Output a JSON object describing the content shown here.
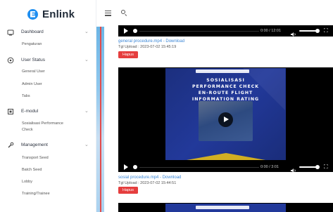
{
  "brand": {
    "name": "Enlink"
  },
  "sidebar": {
    "sections": [
      {
        "label": "Dashboard",
        "icon": "dashboard-icon",
        "items": [
          "Pengaturan"
        ]
      },
      {
        "label": "User Status",
        "icon": "user-status-icon",
        "items": [
          "General User",
          "Admin User",
          "Tabs"
        ]
      },
      {
        "label": "E-modul",
        "icon": "module-icon",
        "items": [
          "Sosialisasi Performance",
          "Check"
        ]
      },
      {
        "label": "Management",
        "icon": "tools-icon",
        "items": [
          "Transport Seed",
          "Batch Seed",
          "Lobby",
          "Training/Trainee"
        ]
      }
    ]
  },
  "videos": [
    {
      "time": "0:00 / 12:01",
      "file_link": "general procedure.mp4 - Download",
      "upload_date": "Tgl Upload : 2023-07-02 15:45:19",
      "delete_label": "Hapus"
    },
    {
      "time": "0:00 / 3:01",
      "file_link": "sosial procedure.mp4 - Download",
      "upload_date": "Tgl Upload : 2023-07-02 15:44:51",
      "delete_label": "Hapus",
      "poster": {
        "line1": "SOSIALISASI",
        "line2": "PERFORMANCE CHECK",
        "line3": "EN-ROUTE FLIGHT",
        "line4": "INFORMATION RATING"
      }
    }
  ],
  "colors": {
    "accent": "#1e8ef0",
    "delete": "#e53e3e",
    "link": "#3a86d6",
    "poster_bg": "#22399a"
  }
}
